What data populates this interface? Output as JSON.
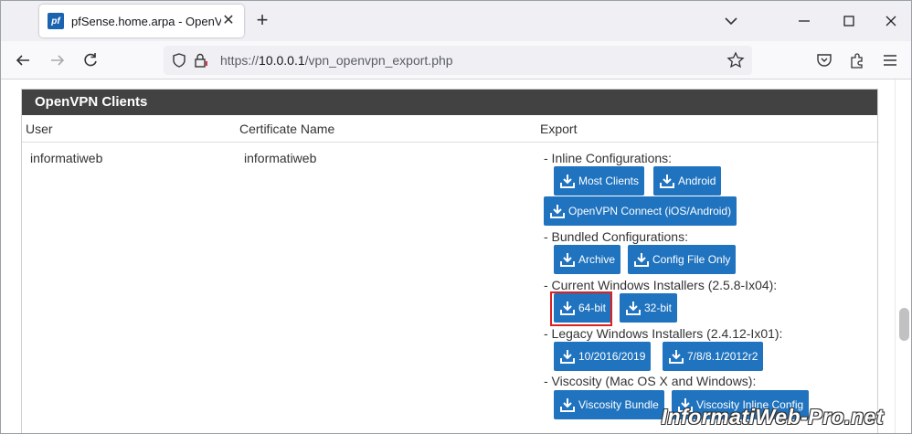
{
  "browser": {
    "tab_title": "pfSense.home.arpa - OpenVPN",
    "favicon_text": "pf",
    "url_prefix": "https://",
    "url_host": "10.0.0.1",
    "url_path": "/vpn_openvpn_export.php"
  },
  "panel": {
    "title": "OpenVPN Clients",
    "columns": [
      "User",
      "Certificate Name",
      "Export"
    ],
    "row": {
      "user": "informatiweb",
      "certificate": "informatiweb"
    }
  },
  "export": {
    "inline_label": "- Inline Configurations:",
    "inline_buttons": [
      "Most Clients",
      "Android",
      "OpenVPN Connect (iOS/Android)"
    ],
    "bundled_label": "- Bundled Configurations:",
    "bundled_buttons": [
      "Archive",
      "Config File Only"
    ],
    "current_label": "- Current Windows Installers (2.5.8-Ix04):",
    "current_buttons": [
      "64-bit",
      "32-bit"
    ],
    "legacy_label": "- Legacy Windows Installers (2.4.12-Ix01):",
    "legacy_buttons": [
      "10/2016/2019",
      "7/8/8.1/2012r2"
    ],
    "viscosity_label": "- Viscosity (Mac OS X and Windows):",
    "viscosity_buttons": [
      "Viscosity Bundle",
      "Viscosity Inline Config"
    ]
  },
  "watermark": "InformatiWeb-Pro.net",
  "colors": {
    "button": "#1f73bf",
    "panel_header": "#424242",
    "highlight": "#e02020"
  }
}
